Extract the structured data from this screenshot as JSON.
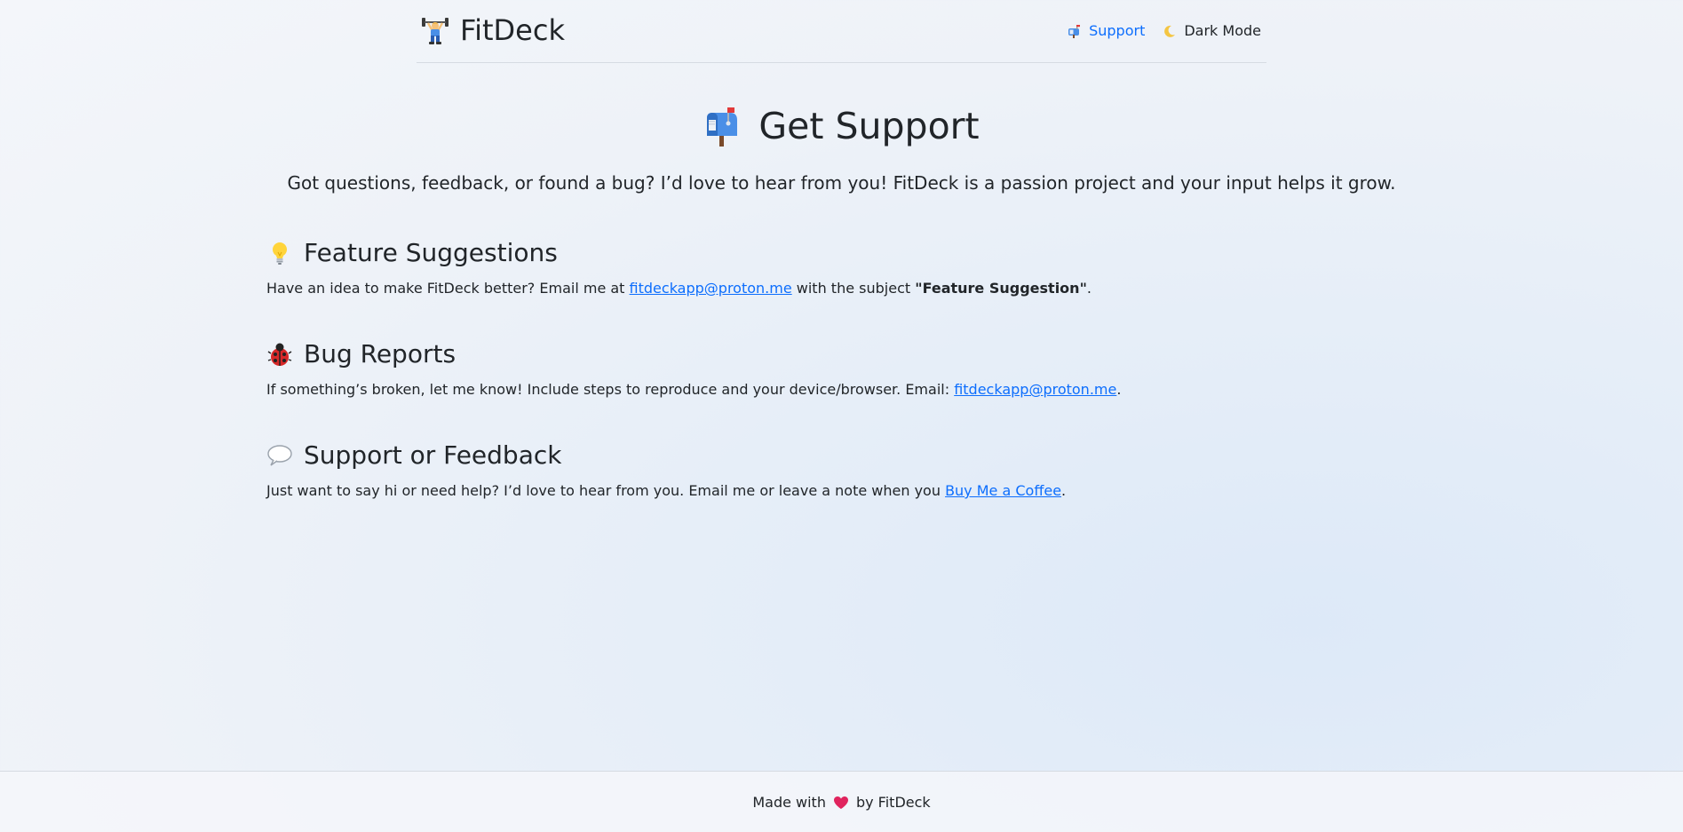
{
  "header": {
    "brand_icon": "weightlifter-icon",
    "brand_name": "FitDeck",
    "nav": {
      "support_icon": "mailbox-icon",
      "support_label": "Support",
      "dark_icon": "crescent-moon-icon",
      "dark_label": "Dark Mode"
    }
  },
  "main": {
    "title_icon": "mailbox-icon",
    "title": "Get Support",
    "lead": "Got questions, feedback, or found a bug? I’d love to hear from you! FitDeck is a passion project and your input helps it grow.",
    "sections": [
      {
        "icon": "lightbulb-icon",
        "title": "Feature Suggestions",
        "text_before": "Have an idea to make FitDeck better? Email me at ",
        "link": "fitdeckapp@proton.me",
        "text_middle": " with the subject ",
        "bold": "\"Feature Suggestion\"",
        "text_after": "."
      },
      {
        "icon": "ladybug-icon",
        "title": "Bug Reports",
        "text_before": "If something’s broken, let me know! Include steps to reproduce and your device/browser. Email: ",
        "link": "fitdeckapp@proton.me",
        "text_after": "."
      },
      {
        "icon": "speech-bubble-icon",
        "title": "Support or Feedback",
        "text_before": "Just want to say hi or need help? I’d love to hear from you. Email me or leave a note when you ",
        "link": "Buy Me a Coffee",
        "text_after": "."
      }
    ]
  },
  "footer": {
    "text_before": "Made with",
    "heart_icon": "heart-icon",
    "text_after": "by FitDeck"
  },
  "colors": {
    "link": "#0d6efd",
    "text": "#212529",
    "heart": "#e0245e",
    "border": "#d6dbe2"
  }
}
